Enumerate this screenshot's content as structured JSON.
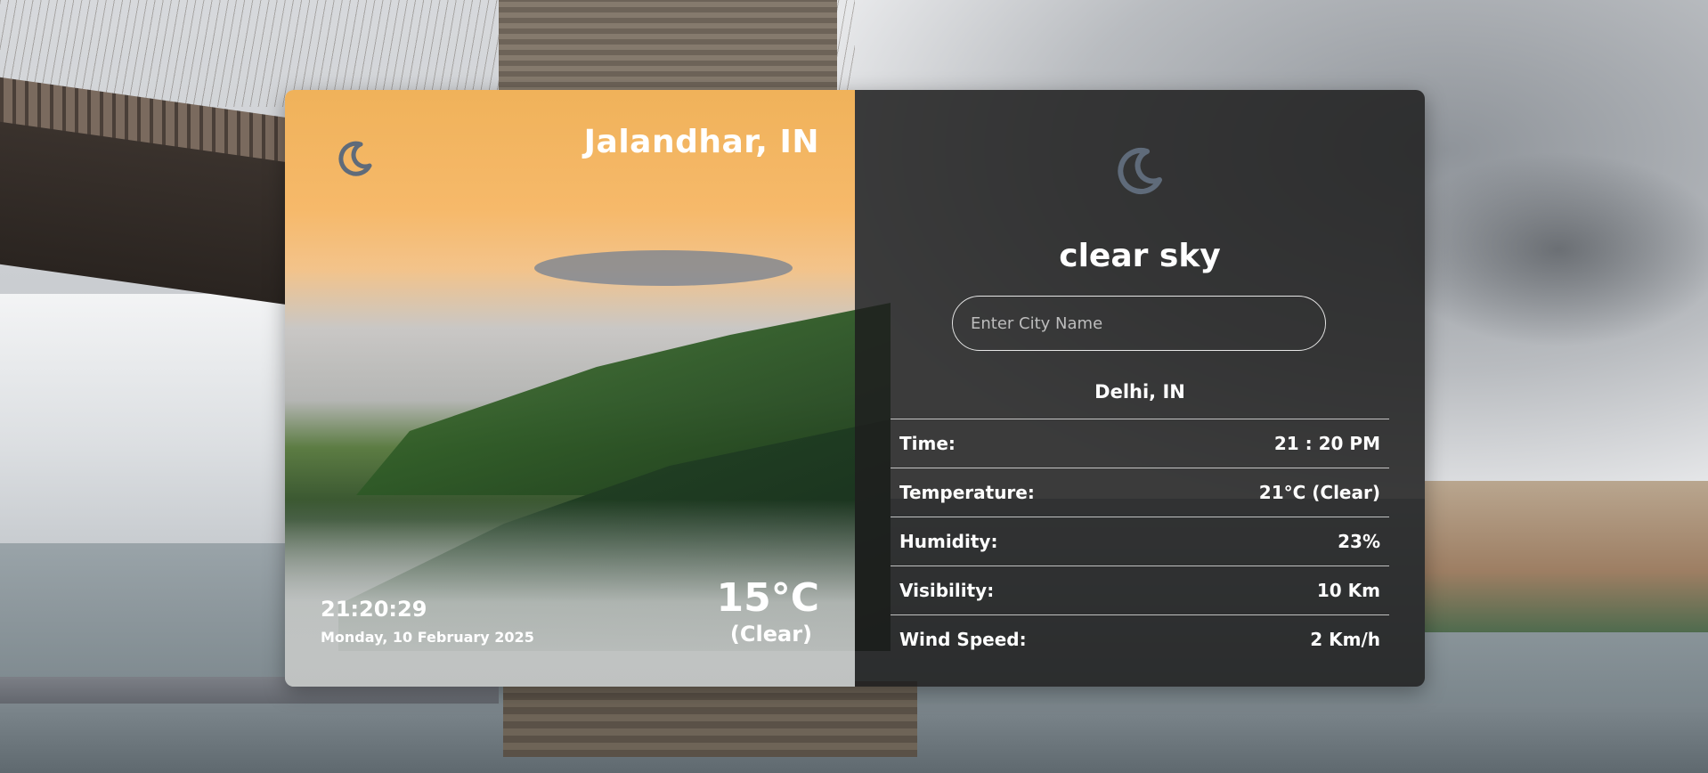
{
  "left_panel": {
    "city": "Jalandhar, IN",
    "time": "21:20:29",
    "date": "Monday, 10 February 2025",
    "temperature": "15°C",
    "condition": "(Clear)",
    "icon": "moon-icon"
  },
  "right_panel": {
    "icon": "moon-icon",
    "description": "clear sky",
    "search": {
      "placeholder": "Enter City Name",
      "value": ""
    },
    "location": "Delhi, IN",
    "rows": [
      {
        "label": "Time:",
        "value": "21 : 20 PM"
      },
      {
        "label": "Temperature:",
        "value": "21°C (Clear)"
      },
      {
        "label": "Humidity:",
        "value": "23%"
      },
      {
        "label": "Visibility:",
        "value": "10 Km"
      },
      {
        "label": "Wind Speed:",
        "value": "2 Km/h"
      }
    ]
  },
  "colors": {
    "panel_dark": "#1e1e1e",
    "text": "#ffffff",
    "icon": "#5f6b7a"
  }
}
